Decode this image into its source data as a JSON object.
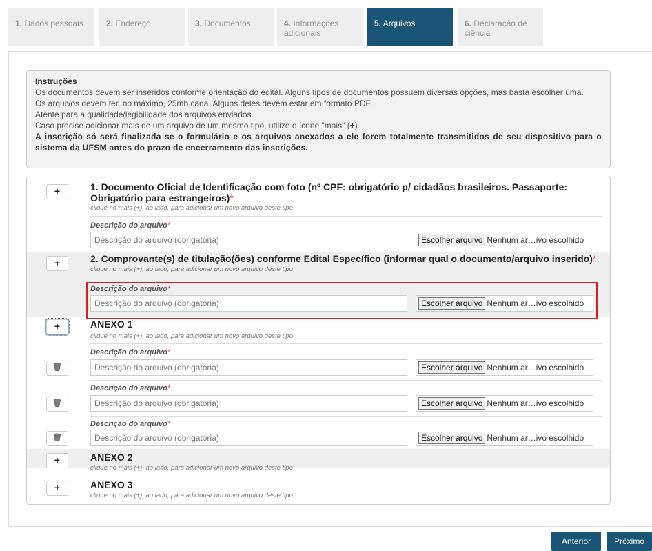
{
  "tabs": [
    {
      "num": "1.",
      "label": "Dados pessoais",
      "active": false
    },
    {
      "num": "2.",
      "label": "Endereço",
      "active": false
    },
    {
      "num": "3.",
      "label": "Documentos",
      "active": false
    },
    {
      "num": "4.",
      "label": "Informações adicionais",
      "active": false
    },
    {
      "num": "5.",
      "label": "Arquivos",
      "active": true
    },
    {
      "num": "6.",
      "label": "Declaração de ciência",
      "active": false
    }
  ],
  "instructions": {
    "heading": "Instruções",
    "line1": "Os documentos devem ser inseridos conforme orientação do edital. Alguns tipos de documentos possuem diversas opções, mas basta escolher uma.",
    "line2": "Os arquivos devem ter, no máximo, 25mb cada. Alguns deles devem estar em formato PDF.",
    "line3": "Atente para a qualidade/legibilidade dos arquivos enviados.",
    "line4_pre": "Caso precise adicionar mais de um arquivo de um mesmo tipo, utilize o ícone \"mais\" (",
    "line4_post": ").",
    "bold": "A inscrição só será finalizada se o formulário e os arquivos anexados a ele forem totalmente transmitidos de seu dispositivo para o sistema da UFSM antes do prazo de encerramento das inscrições."
  },
  "common": {
    "plus": "+",
    "trash": "🗑",
    "required_mark": "*",
    "hint": "clique no mais (+), ao lado, para adicionar um novo arquivo deste tipo",
    "field_label": "Descrição do arquivo",
    "field_placeholder": "Descrição do arquivo (obrigatória)",
    "choose_file": "Escolher arquivo",
    "no_file": "Nenhum ar…ivo escolhido"
  },
  "sections": [
    {
      "title_line1": "1. Documento Oficial de Identificação com foto (nº CPF: obrigatório p/ cidadãos brasileiros. Passaporte:",
      "title_line2": "Obrigatório para estrangeiros)"
    },
    {
      "title": "2. Comprovante(s) de titulação(ões) conforme Edital Específico (informar qual o documento/arquivo inserido)"
    },
    {
      "title": "ANEXO 1"
    },
    {
      "title": "ANEXO 2"
    },
    {
      "title": "ANEXO 3"
    }
  ],
  "nav": {
    "previous": "Anterior",
    "next": "Próximo"
  }
}
